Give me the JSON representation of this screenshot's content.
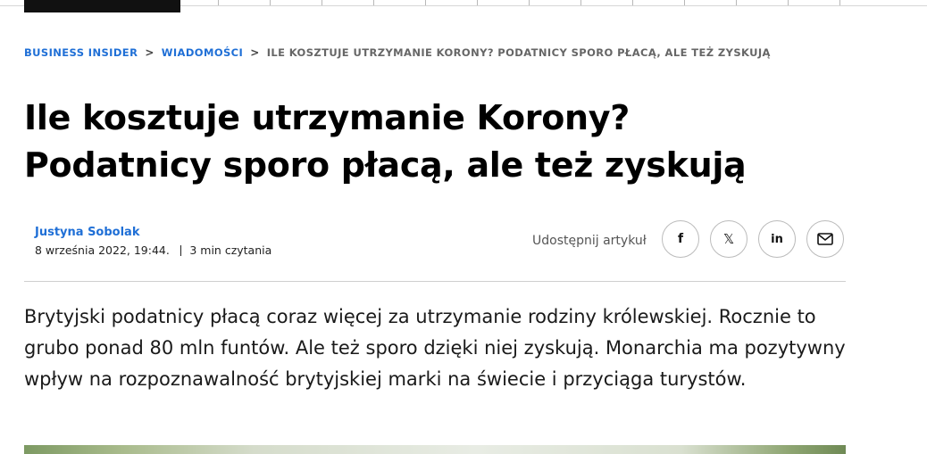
{
  "breadcrumb": {
    "items": [
      "BUSINESS INSIDER",
      "WIADOMOŚCI"
    ],
    "separator": ">",
    "current": "ILE KOSZTUJE UTRZYMANIE KORONY? PODATNICY SPORO PŁACĄ, ALE TEŻ ZYSKUJĄ"
  },
  "article": {
    "title_line1": "Ile kosztuje utrzymanie Korony?",
    "title_line2": "Podatnicy sporo płacą, ale też zyskują",
    "author": "Justyna Sobolak",
    "date": "8 września 2022, 19:44.",
    "read_time": "3 min czytania",
    "lead": "Brytyjski podatnicy płacą coraz więcej za utrzymanie rodziny królewskiej. Rocznie to grubo ponad 80 mln funtów. Ale też sporo dzięki niej zyskują. Monarchia ma pozytywny wpływ na rozpoznawalność brytyjskiej marki na świecie i przyciąga turystów."
  },
  "share": {
    "label": "Udostępnij artykuł",
    "buttons": [
      {
        "icon": "facebook-icon",
        "glyph": "f"
      },
      {
        "icon": "x-icon",
        "glyph": "𝕏"
      },
      {
        "icon": "linkedin-icon",
        "glyph": "in"
      },
      {
        "icon": "email-icon",
        "glyph": ""
      }
    ]
  },
  "colors": {
    "link": "#1f6fd6",
    "text": "#000000",
    "muted": "#666666",
    "divider": "#cfcfcf"
  }
}
